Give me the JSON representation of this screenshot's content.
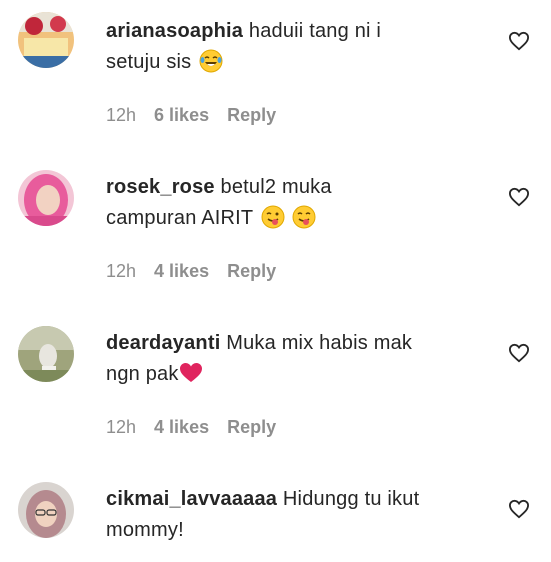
{
  "comments": [
    {
      "username": "arianasoaphia",
      "text_line1": "haduii tang ni i",
      "text_line2": "setuju sis",
      "emoji_icons": [
        "laughing-tears-emoji"
      ],
      "time": "12h",
      "likes": "6 likes",
      "reply": "Reply"
    },
    {
      "username": "rosek_rose",
      "text_line1": "betul2 muka",
      "text_line2": "campuran AIRIT",
      "emoji_icons": [
        "tongue-wink-emoji",
        "tongue-wink-emoji"
      ],
      "time": "12h",
      "likes": "4 likes",
      "reply": "Reply"
    },
    {
      "username": "deardayanti",
      "text_line1": "Muka mix habis mak",
      "text_line2": "ngn pak",
      "emoji_icons": [
        "red-heart-emoji"
      ],
      "time": "12h",
      "likes": "4 likes",
      "reply": "Reply"
    },
    {
      "username": "cikmai_lavvaaaaa",
      "text_line1": "Hidungg tu ikut",
      "text_line2": "mommy!",
      "emoji_icons": [],
      "time": "",
      "likes": "",
      "reply": ""
    }
  ],
  "colors": {
    "text": "#262626",
    "meta": "#8e8e8e",
    "heart_outline": "#262626",
    "emoji_heart": "#e0245e"
  },
  "icons": {
    "like": "heart-outline-icon"
  }
}
